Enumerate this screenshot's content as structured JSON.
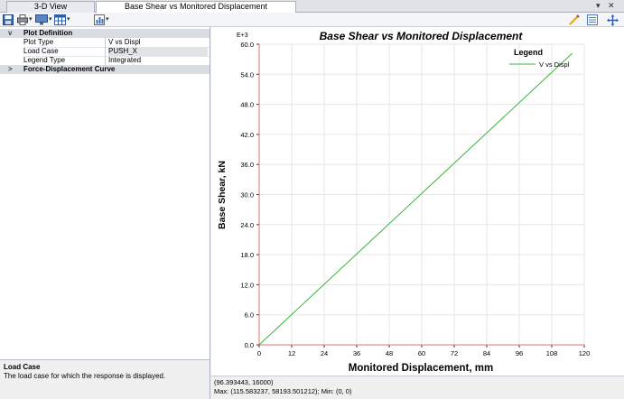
{
  "tabs": [
    {
      "label": "3-D View"
    },
    {
      "label": "Base Shear vs Monitored Displacement"
    }
  ],
  "window_controls": {
    "menu": "▾",
    "close": "✕"
  },
  "properties": {
    "category_plot": "Plot Definition",
    "rows": [
      {
        "key": "Plot Type",
        "value": "V vs Displ"
      },
      {
        "key": "Load Case",
        "value": "PUSH_X"
      },
      {
        "key": "Legend Type",
        "value": "Integrated"
      }
    ],
    "category_curve": "Force-Displacement Curve",
    "expanded_glyph": "v",
    "collapsed_glyph": ">"
  },
  "description": {
    "title": "Load Case",
    "text": "The load case for which the response is displayed."
  },
  "status": {
    "cursor": "(96.393443, 16000)",
    "maxmin": "Max: (115.583237, 58193.501212);   Min: (0, 0)"
  },
  "colors": {
    "series": "#3cb43c",
    "axis": "#e07070",
    "grid": "#e6e6e6"
  },
  "chart_data": {
    "type": "line",
    "title": "Base Shear vs Monitored Displacement",
    "xlabel": "Monitored Displacement, mm",
    "ylabel": "Base Shear, kN",
    "y_multiplier": "E+3",
    "xlim": [
      0,
      120
    ],
    "ylim": [
      0,
      60
    ],
    "x_ticks": [
      "0",
      "12",
      "24",
      "36",
      "48",
      "60",
      "72",
      "84",
      "96",
      "108",
      "120"
    ],
    "y_ticks": [
      "0.0",
      "6.0",
      "12.0",
      "18.0",
      "24.0",
      "30.0",
      "36.0",
      "42.0",
      "48.0",
      "54.0",
      "60.0"
    ],
    "legend_title": "Legend",
    "legend_position": "top-right",
    "series": [
      {
        "name": "V vs Displ",
        "x": [
          0,
          115.583237
        ],
        "y": [
          0,
          58.193501
        ]
      }
    ]
  }
}
